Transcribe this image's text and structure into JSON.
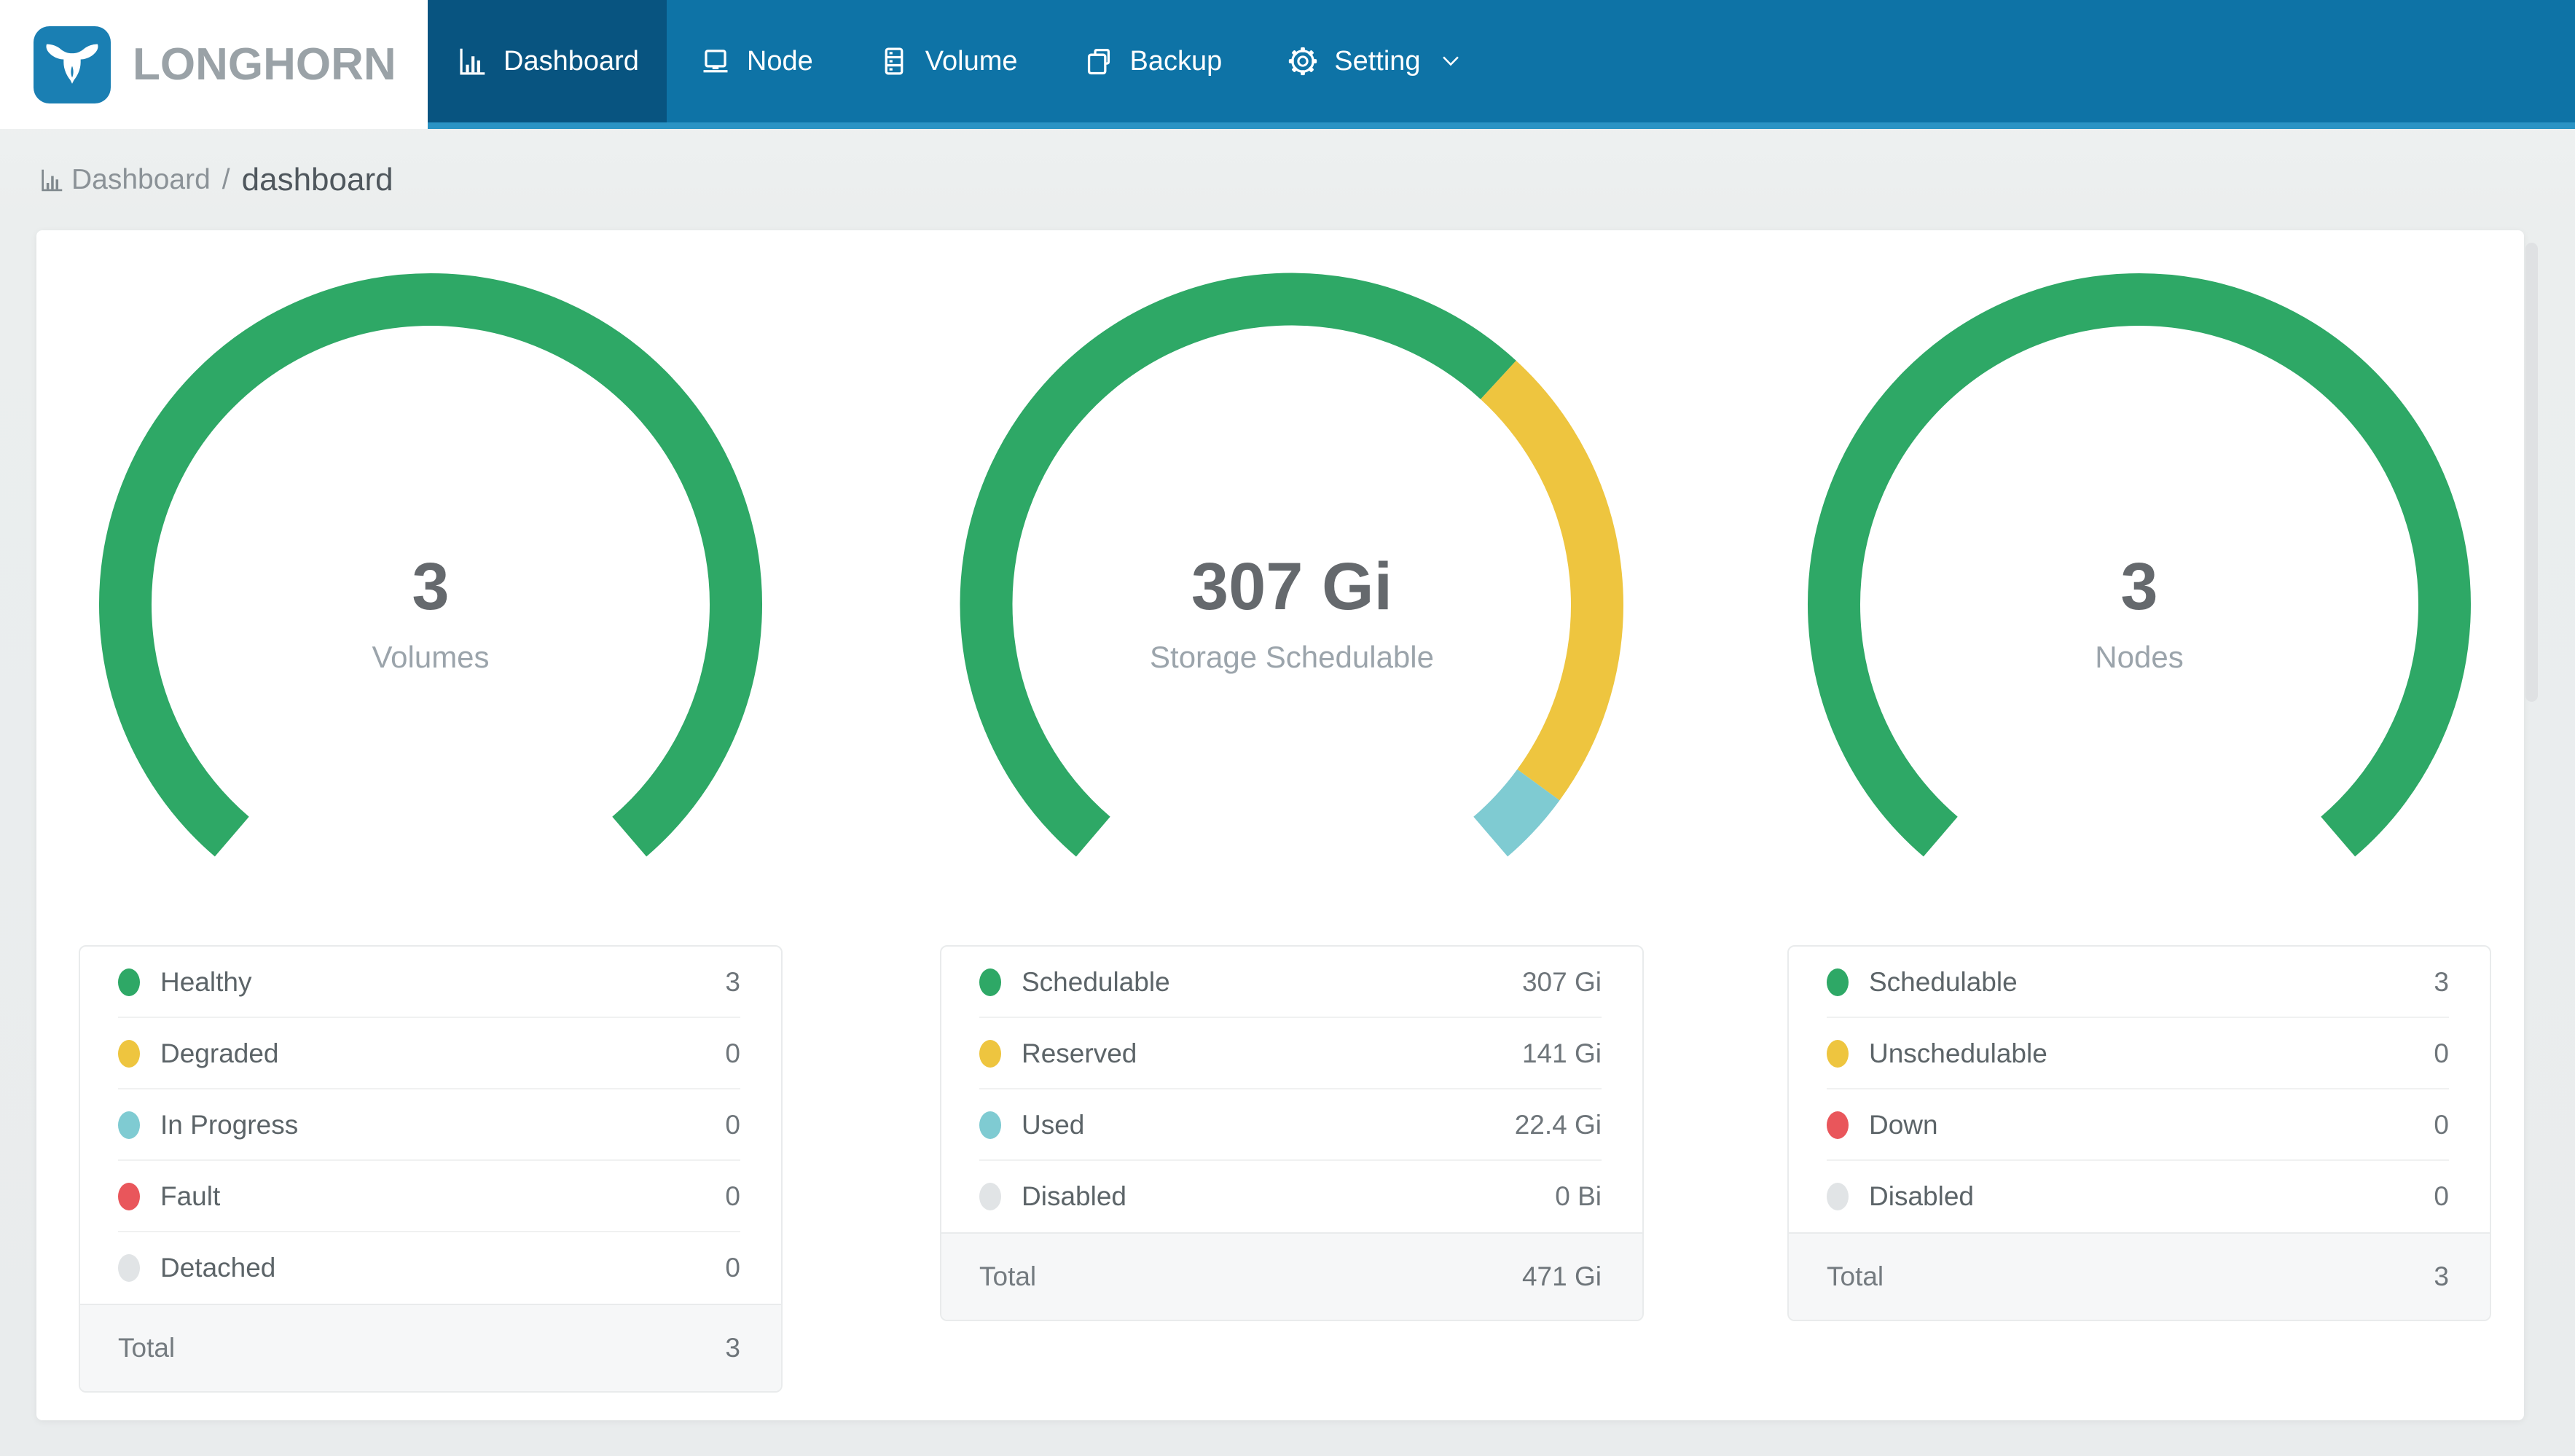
{
  "nav": {
    "brand": "LONGHORN",
    "items": [
      {
        "label": "Dashboard",
        "icon": "bar-chart",
        "active": true
      },
      {
        "label": "Node",
        "icon": "laptop",
        "active": false
      },
      {
        "label": "Volume",
        "icon": "storage-stack",
        "active": false
      },
      {
        "label": "Backup",
        "icon": "copy",
        "active": false
      },
      {
        "label": "Setting",
        "icon": "gear",
        "active": false,
        "has_dropdown": true
      }
    ]
  },
  "breadcrumb": {
    "section": "Dashboard",
    "separator": "/",
    "page": "dashboard"
  },
  "colors": {
    "navbar": "#0e73a6",
    "navbar_active_tab": "#085480",
    "navbar_bottom_strip": "#2a93c4",
    "logo_blue": "#1a7fb3",
    "healthy_green": "#2ea866",
    "warning_yellow": "#eec53f",
    "progress_teal": "#7fcbd2",
    "fault_red": "#e9565b",
    "disabled_gray": "#e1e4e6"
  },
  "chart_data": [
    {
      "type": "gauge",
      "center_value": "3",
      "center_label": "Volumes",
      "start_angle": 229.4,
      "sweep_angle": 278.8,
      "segments": [
        {
          "name": "Healthy",
          "value": 3,
          "color": "#2ea866"
        }
      ],
      "legend": {
        "rows": [
          {
            "label": "Healthy",
            "value": "3",
            "color": "#2ea866"
          },
          {
            "label": "Degraded",
            "value": "0",
            "color": "#eec53f"
          },
          {
            "label": "In Progress",
            "value": "0",
            "color": "#7fcbd2"
          },
          {
            "label": "Fault",
            "value": "0",
            "color": "#e9565b"
          },
          {
            "label": "Detached",
            "value": "0",
            "color": "#e1e4e6"
          }
        ],
        "total_label": "Total",
        "total_value": "3"
      }
    },
    {
      "type": "gauge",
      "center_value": "307 Gi",
      "center_label": "Storage Schedulable",
      "start_angle": 229.4,
      "sweep_angle": 278.8,
      "segments": [
        {
          "name": "Schedulable",
          "value": 307,
          "color": "#2ea866"
        },
        {
          "name": "Reserved",
          "value": 141,
          "color": "#eec53f"
        },
        {
          "name": "Used",
          "value": 22.4,
          "color": "#7fcbd2"
        }
      ],
      "legend": {
        "rows": [
          {
            "label": "Schedulable",
            "value": "307 Gi",
            "color": "#2ea866"
          },
          {
            "label": "Reserved",
            "value": "141 Gi",
            "color": "#eec53f"
          },
          {
            "label": "Used",
            "value": "22.4 Gi",
            "color": "#7fcbd2"
          },
          {
            "label": "Disabled",
            "value": "0 Bi",
            "color": "#e1e4e6"
          }
        ],
        "total_label": "Total",
        "total_value": "471 Gi"
      }
    },
    {
      "type": "gauge",
      "center_value": "3",
      "center_label": "Nodes",
      "start_angle": 229.4,
      "sweep_angle": 278.8,
      "segments": [
        {
          "name": "Schedulable",
          "value": 3,
          "color": "#2ea866"
        }
      ],
      "legend": {
        "rows": [
          {
            "label": "Schedulable",
            "value": "3",
            "color": "#2ea866"
          },
          {
            "label": "Unschedulable",
            "value": "0",
            "color": "#eec53f"
          },
          {
            "label": "Down",
            "value": "0",
            "color": "#e9565b"
          },
          {
            "label": "Disabled",
            "value": "0",
            "color": "#e1e4e6"
          }
        ],
        "total_label": "Total",
        "total_value": "3"
      }
    }
  ]
}
